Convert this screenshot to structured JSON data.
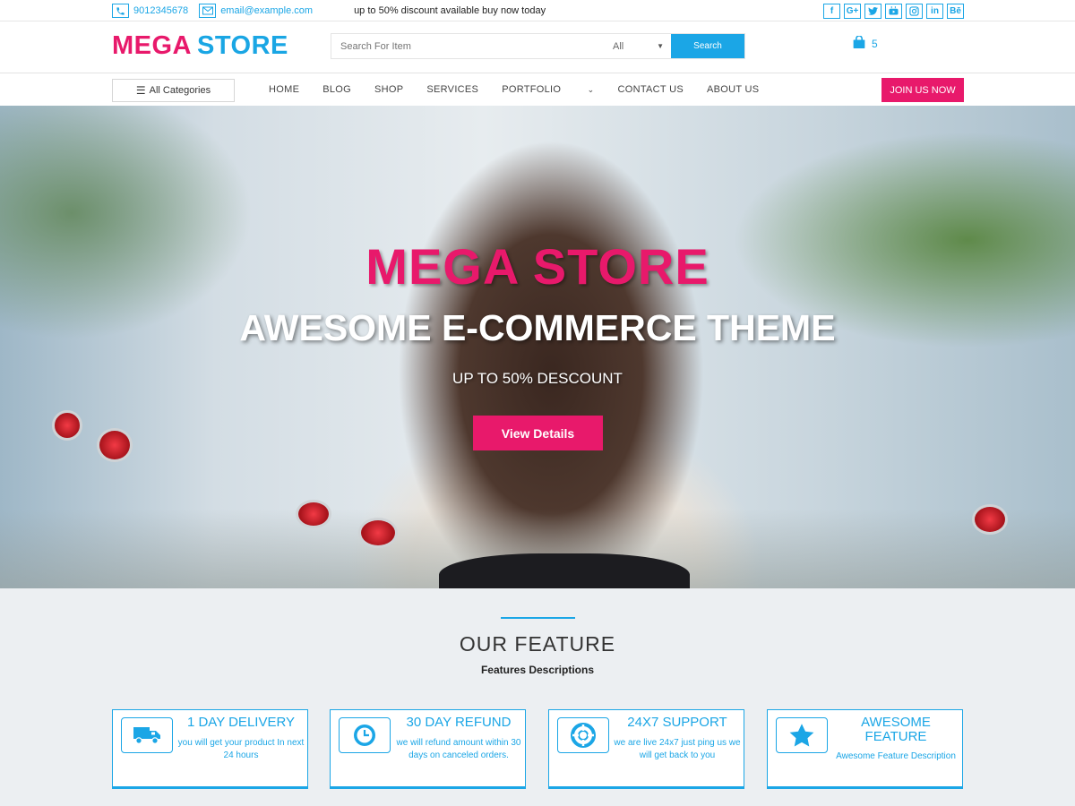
{
  "topbar": {
    "phone": "9012345678",
    "email": "email@example.com",
    "promo": "up to 50% discount available buy now today",
    "socials": [
      "f",
      "G+",
      "t",
      "yt",
      "ig",
      "in",
      "Bē"
    ]
  },
  "header": {
    "logo_a": "MEGA",
    "logo_b": "STORE",
    "search_placeholder": "Search For Item",
    "category": "All",
    "search_button": "Search",
    "cart_count": "5"
  },
  "nav": {
    "all_categories": "All Categories",
    "items": [
      "HOME",
      "BLOG",
      "SHOP",
      "SERVICES",
      "PORTFOLIO",
      "CONTACT US",
      "ABOUT US"
    ],
    "join": "JOIN US NOW"
  },
  "hero": {
    "title": "MEGA STORE",
    "subtitle": "AWESOME E-COMMERCE THEME",
    "discount": "UP TO 50% DESCOUNT",
    "button": "View Details"
  },
  "features": {
    "title": "OUR FEATURE",
    "description": "Features Descriptions",
    "cards": [
      {
        "title": "1 DAY DELIVERY",
        "text": "you will get your product In next 24 hours",
        "icon": "truck-icon"
      },
      {
        "title": "30 DAY REFUND",
        "text": "we will refund amount within 30 days on canceled orders.",
        "icon": "clock-icon"
      },
      {
        "title": "24X7 SUPPORT",
        "text": "we are live 24x7 just ping us we will get back to you",
        "icon": "lifebuoy-icon"
      },
      {
        "title": "AWESOME FEATURE",
        "text": "Awesome Feature Description",
        "icon": "star-icon"
      }
    ]
  },
  "colors": {
    "brand_pink": "#e8196b",
    "brand_blue": "#1ba6e6"
  }
}
